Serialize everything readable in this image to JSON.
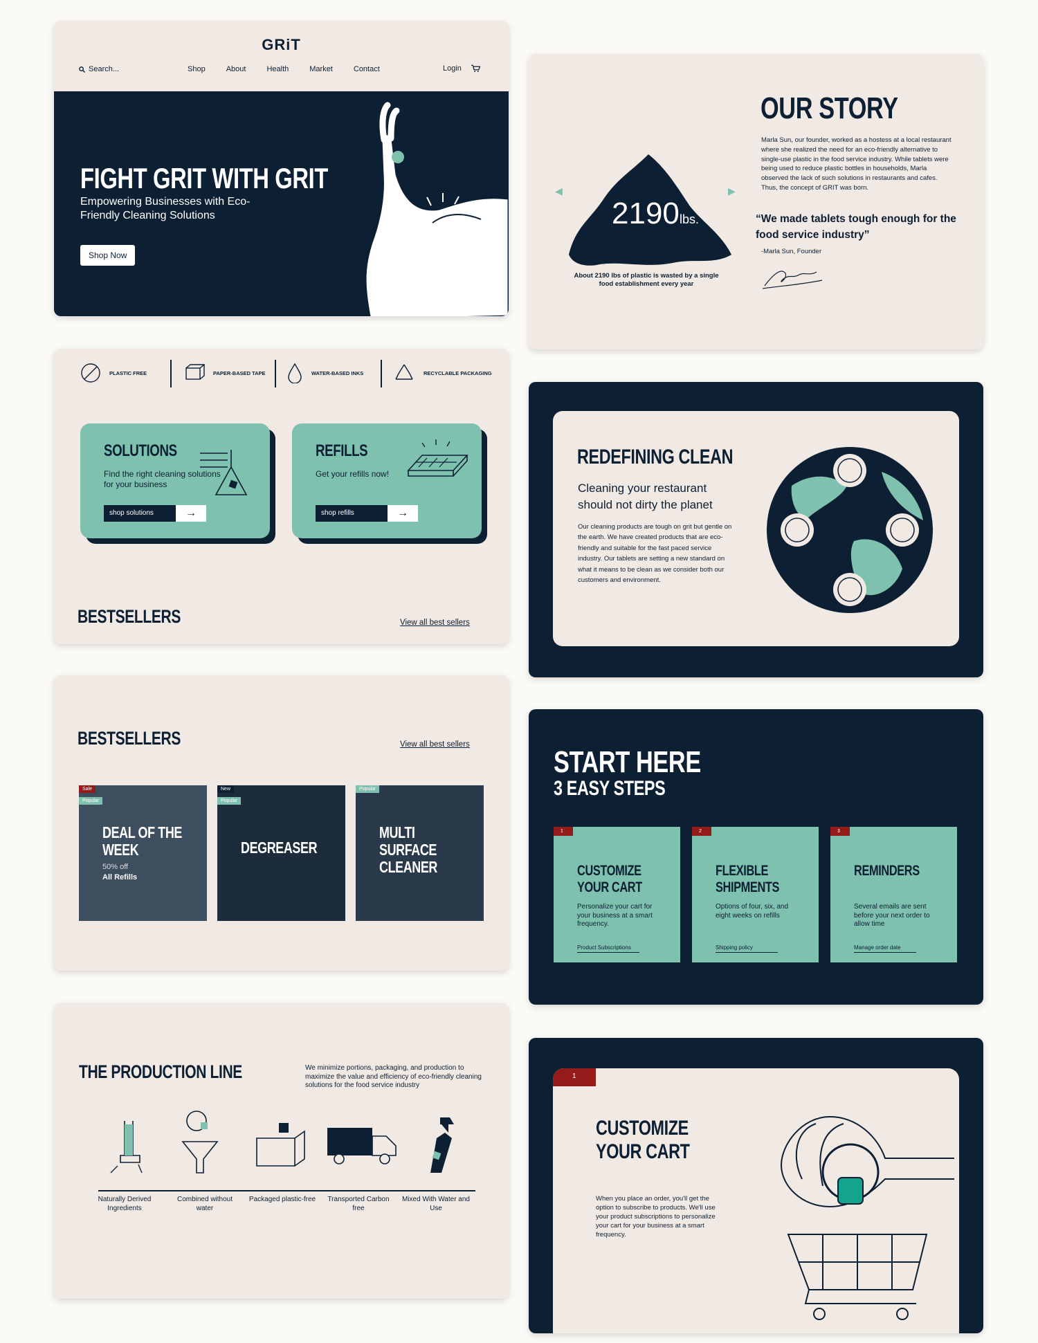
{
  "colors": {
    "navy": "#0d1f33",
    "teal": "#7ec1ae",
    "beige": "#f1e9e3",
    "red": "#951a1a"
  },
  "hero": {
    "logo": "GRiT",
    "search_placeholder": "Search...",
    "nav": [
      "Shop",
      "About",
      "Health",
      "Market",
      "Contact"
    ],
    "login": "Login",
    "title": "FIGHT GRIT WITH GRIT",
    "subtitle": "Empowering Businesses with Eco-Friendly Cleaning Solutions",
    "cta": "Shop Now"
  },
  "story": {
    "title": "OUR STORY",
    "body": "Marla Sun, our founder, worked as a hostess at a local restaurant where she realized the need for an eco-friendly alternative to single-use plastic in the food service industry. While tablets were being used to reduce plastic bottles in households, Marla observed the lack of such solutions in restaurants and cafes. Thus, the concept of GRIT was born.",
    "quote": "“We made tablets tough enough for the food service industry”",
    "attribution": "-Marla Sun, Founder",
    "stat": "2190",
    "stat_unit": "lbs.",
    "caption": "About 2190 lbs of plastic is wasted by a single food establishment every year"
  },
  "features": {
    "items": [
      "PLASTIC FREE",
      "PAPER-BASED TAPE",
      "WATER-BASED INKS",
      "RECYCLABLE PACKAGING"
    ],
    "tiles": [
      {
        "title": "SOLUTIONS",
        "text": "Find the right cleaning solutions for your business",
        "button": "shop solutions"
      },
      {
        "title": "REFILLS",
        "text": "Get your refills now!",
        "button": "shop refills"
      }
    ],
    "bestsellers_title": "BESTSELLERS",
    "view_all": "View all best sellers"
  },
  "redefining": {
    "title": "REDEFINING CLEAN",
    "lead": "Cleaning your restaurant should not dirty the planet",
    "body": "Our cleaning products are tough on grit but gentle on the earth. We have created products that are eco-friendly and suitable for the fast paced service industry. Our tablets are setting a new standard on what it means to be clean as we consider both our customers and environment."
  },
  "bestsellers": {
    "title": "BESTSELLERS",
    "view_all": "View all best sellers",
    "products": [
      {
        "badges": [
          "Sale",
          "Popular"
        ],
        "name": "DEAL OF THE WEEK",
        "detail": "50% off",
        "detail2": "All Refills"
      },
      {
        "badges": [
          "New",
          "Popular"
        ],
        "name": "DEGREASER"
      },
      {
        "badges": [
          "Popular"
        ],
        "name": "MULTI SURFACE CLEANER"
      }
    ]
  },
  "start": {
    "title": "START HERE",
    "subtitle": "3 EASY STEPS",
    "steps": [
      {
        "num": "1",
        "title": "CUSTOMIZE YOUR CART",
        "text": "Personalize your cart for your business at a smart frequency.",
        "link": "Product Subscriptions"
      },
      {
        "num": "2",
        "title": "FLEXIBLE SHIPMENTS",
        "text": "Options of four, six, and eight weeks on refills",
        "link": "Shipping policy"
      },
      {
        "num": "3",
        "title": "REMINDERS",
        "text": "Several emails are sent before your next order to allow time",
        "link": "Manage order date"
      }
    ]
  },
  "production": {
    "title": "THE PRODUCTION LINE",
    "intro": "We minimize portions, packaging, and production to maximize the value and efficiency of eco-friendly cleaning solutions for the food service industry",
    "steps": [
      "Naturally Derived Ingredients",
      "Combined without water",
      "Packaged plastic-free",
      "Transported Carbon free",
      "Mixed With Water and Use"
    ]
  },
  "customize": {
    "num": "1",
    "title": "CUSTOMIZE YOUR CART",
    "body": "When you place an order, you'll get the option to subscribe to products. We'll use your product subscriptions to personalize your cart for your business at a smart frequency."
  }
}
